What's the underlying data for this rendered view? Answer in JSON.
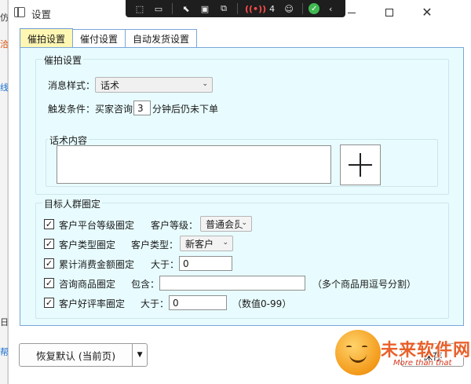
{
  "window": {
    "title": "设置"
  },
  "recorder_toolbar": {
    "count": "4"
  },
  "tabs": [
    {
      "label": "催拍设置",
      "active": true
    },
    {
      "label": "催付设置",
      "active": false
    },
    {
      "label": "自动发货设置",
      "active": false
    }
  ],
  "reminder": {
    "group_title": "催拍设置",
    "message_style_label": "消息样式：",
    "message_style_value": "话术",
    "trigger_prefix": "触发条件：买家咨询",
    "trigger_minutes": "3",
    "trigger_suffix": "分钟后仍未下单",
    "script_group_title": "话术内容"
  },
  "targeting": {
    "group_title": "目标人群圈定",
    "rows": [
      {
        "label": "客户平台等级圈定",
        "checked": true,
        "field_label": "客户等级：",
        "field_value": "普通会员"
      },
      {
        "label": "客户类型圈定",
        "checked": true,
        "field_label": "客户类型：",
        "field_value": "新客户"
      },
      {
        "label": "累计消费金额圈定",
        "checked": true,
        "field_label": "大于：",
        "field_value": "0"
      },
      {
        "label": "咨询商品圈定",
        "checked": true,
        "field_label": "包含：",
        "field_value": "",
        "hint": "（多个商品用逗号分割）"
      },
      {
        "label": "客户好评率圈定",
        "checked": true,
        "field_label": "大于：",
        "field_value": "0",
        "hint": "（数值0-99）"
      }
    ]
  },
  "footer": {
    "reset_label": "恢复默认 (当前页)",
    "save_label": "保存"
  },
  "watermark": {
    "text": "未来软件网",
    "sub": "More than that"
  },
  "colors": {
    "active_tab": "#fff7b3",
    "panel_bg": "#e8fcff",
    "tab_border": "#7aa7d8"
  }
}
